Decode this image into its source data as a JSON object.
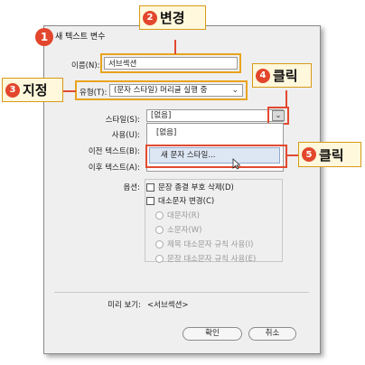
{
  "dialog": {
    "title": "새 텍스트 변수",
    "name_label": "이름(N):",
    "name_value": "서브섹션",
    "type_label": "유형(T):",
    "type_value": "(문자 스타일) 머리글 실행 중",
    "style_label": "스타일(S):",
    "style_value": "[없음]",
    "use_label": "사용(U):",
    "before_label": "이전 텍스트(B):",
    "after_label": "이후 텍스트(A):",
    "options_label": "옵션:",
    "options": [
      {
        "label": "문장 종결 부호 삭제(D)",
        "kind": "checkbox",
        "enabled": true
      },
      {
        "label": "대소문자 변경(C)",
        "kind": "checkbox",
        "enabled": true
      },
      {
        "label": "대문자(R)",
        "kind": "radio",
        "enabled": false
      },
      {
        "label": "소문자(W)",
        "kind": "radio",
        "enabled": false
      },
      {
        "label": "제목 대소문자 규칙 사용(I)",
        "kind": "radio",
        "enabled": false
      },
      {
        "label": "문장 대소문자 규칙 사용(E)",
        "kind": "radio",
        "enabled": false
      }
    ],
    "preview_label": "미리 보기:",
    "preview_value": "<서브섹션>",
    "ok_button": "확인",
    "cancel_button": "취소",
    "style_dropdown": {
      "items": [
        "[없음]",
        "새 문자 스타일..."
      ],
      "highlighted_index": 1
    }
  },
  "callouts": {
    "step1": "1",
    "step2_num": "2",
    "step2_text": "변경",
    "step3_num": "3",
    "step3_text": "지정",
    "step4_num": "4",
    "step4_text": "클릭",
    "step5_num": "5",
    "step5_text": "클릭"
  },
  "colors": {
    "accent_red": "#e24a31",
    "highlight_orange": "#e8a41e",
    "callout_fill": "#fff8dc"
  },
  "icons": [
    "chevron-down-icon",
    "mouse-cursor-icon"
  ]
}
